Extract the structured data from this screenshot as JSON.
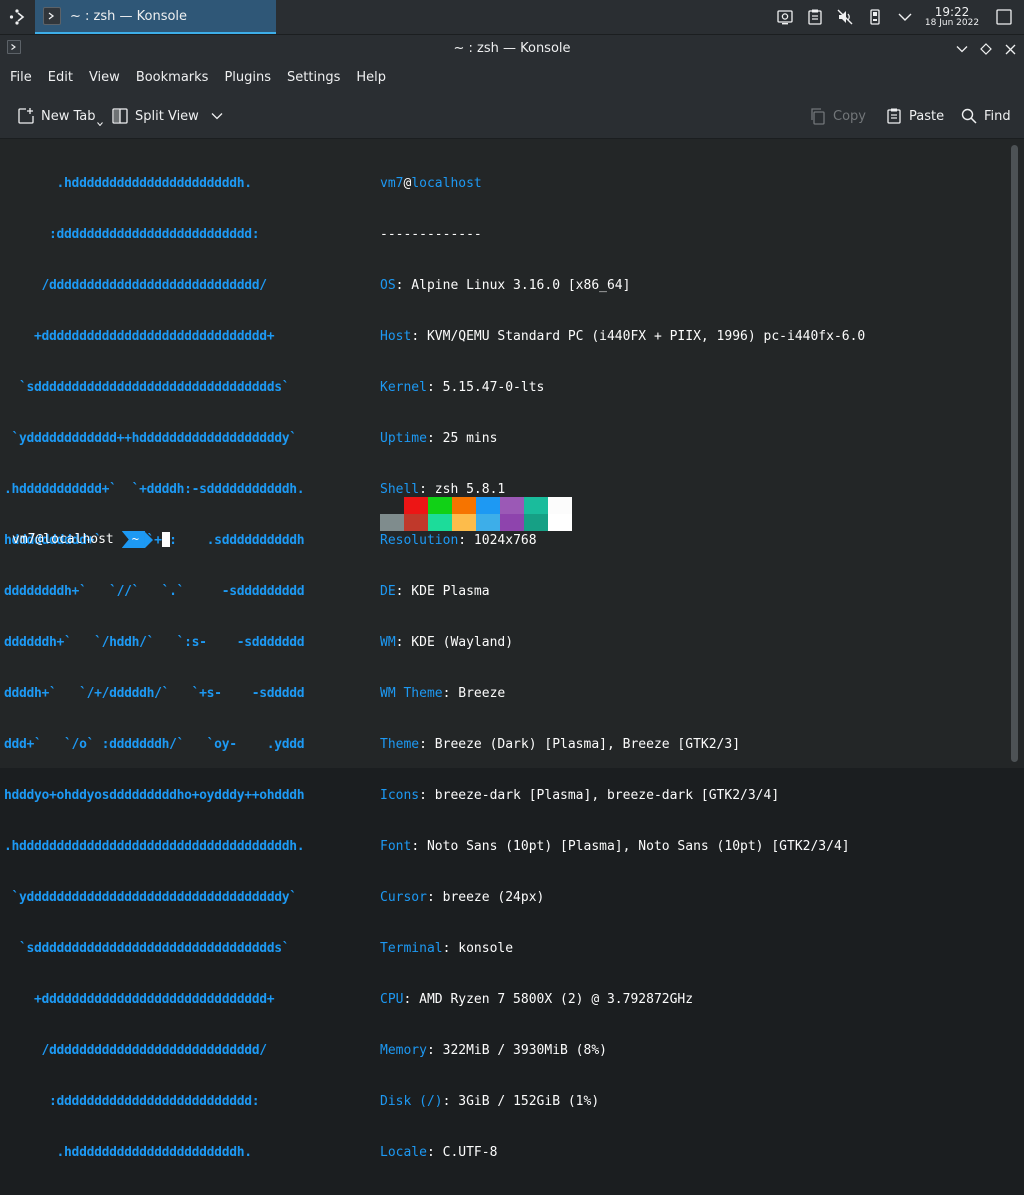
{
  "panel": {
    "task_title": "~ : zsh — Konsole",
    "clock_time": "19:22",
    "clock_date": "18 Jun 2022"
  },
  "window": {
    "title": "~ : zsh — Konsole"
  },
  "menubar": {
    "items": [
      "File",
      "Edit",
      "View",
      "Bookmarks",
      "Plugins",
      "Settings",
      "Help"
    ]
  },
  "toolbar": {
    "new_tab": "New Tab",
    "split_view": "Split View",
    "copy": "Copy",
    "paste": "Paste",
    "find": "Find"
  },
  "terminal": {
    "ascii_art": [
      "       .hddddddddddddddddddddddh.",
      "      :dddddddddddddddddddddddddd:",
      "     /dddddddddddddddddddddddddddd/",
      "    +dddddddddddddddddddddddddddddd+",
      "  `sdddddddddddddddddddddddddddddddds`",
      " `ydddddddddddd++hdddddddddddddddddddy`",
      ".hddddddddddd+`  `+ddddh:-sdddddddddddh.",
      "hdddddddddd+`      `+y:    .sddddddddddh",
      "ddddddddh+`   `//`   `.`     -sddddddddd",
      "ddddddh+`   `/hddh/`   `:s-    -sddddddd",
      "ddddh+`   `/+/dddddh/`   `+s-    -sddddd",
      "ddd+`   `/o` :dddddddh/`   `oy-    .yddd",
      "hdddyo+ohddyosdddddddddho+oydddy++ohdddh",
      ".hddddddddddddddddddddddddddddddddddddh.",
      " `yddddddddddddddddddddddddddddddddddy`",
      "  `sdddddddddddddddddddddddddddddddds`",
      "    +dddddddddddddddddddddddddddddd+",
      "     /dddddddddddddddddddddddddddd/",
      "      :dddddddddddddddddddddddddd:",
      "       .hddddddddddddddddddddddh."
    ],
    "user": "vm7",
    "at": "@",
    "host": "localhost",
    "separator": "-------------",
    "info": [
      {
        "key": "OS",
        "value": ": Alpine Linux 3.16.0 [x86_64]"
      },
      {
        "key": "Host",
        "value": ": KVM/QEMU Standard PC (i440FX + PIIX, 1996) pc-i440fx-6.0"
      },
      {
        "key": "Kernel",
        "value": ": 5.15.47-0-lts"
      },
      {
        "key": "Uptime",
        "value": ": 25 mins"
      },
      {
        "key": "Shell",
        "value": ": zsh 5.8.1"
      },
      {
        "key": "Resolution",
        "value": ": 1024x768"
      },
      {
        "key": "DE",
        "value": ": KDE Plasma"
      },
      {
        "key": "WM",
        "value": ": KDE (Wayland)"
      },
      {
        "key": "WM Theme",
        "value": ": Breeze"
      },
      {
        "key": "Theme",
        "value": ": Breeze (Dark) [Plasma], Breeze [GTK2/3]"
      },
      {
        "key": "Icons",
        "value": ": breeze-dark [Plasma], breeze-dark [GTK2/3/4]"
      },
      {
        "key": "Font",
        "value": ": Noto Sans (10pt) [Plasma], Noto Sans (10pt) [GTK2/3/4]"
      },
      {
        "key": "Cursor",
        "value": ": breeze (24px)"
      },
      {
        "key": "Terminal",
        "value": ": konsole"
      },
      {
        "key": "CPU",
        "value": ": AMD Ryzen 7 5800X (2) @ 3.792872GHz"
      },
      {
        "key": "Memory",
        "value": ": 322MiB / 3930MiB (8%)"
      },
      {
        "key": "Disk (/)",
        "value": ": 3GiB / 152GiB (1%)"
      },
      {
        "key": "Locale",
        "value": ": C.UTF-8"
      }
    ],
    "palette_row1": [
      "#232627",
      "#ed1515",
      "#11d116",
      "#f67400",
      "#1d99f3",
      "#9b59b6",
      "#1abc9c",
      "#fcfcfc"
    ],
    "palette_row2": [
      "#7f8c8d",
      "#c0392b",
      "#1cdc9a",
      "#fdbc4b",
      "#3daee9",
      "#8e44ad",
      "#16a085",
      "#ffffff"
    ],
    "prompt_user": "vm7@localhost",
    "prompt_dir": "~"
  },
  "colors": {
    "accent": "#1d99f3",
    "panel_bg": "#2a2e32",
    "terminal_bg": "#232627"
  }
}
